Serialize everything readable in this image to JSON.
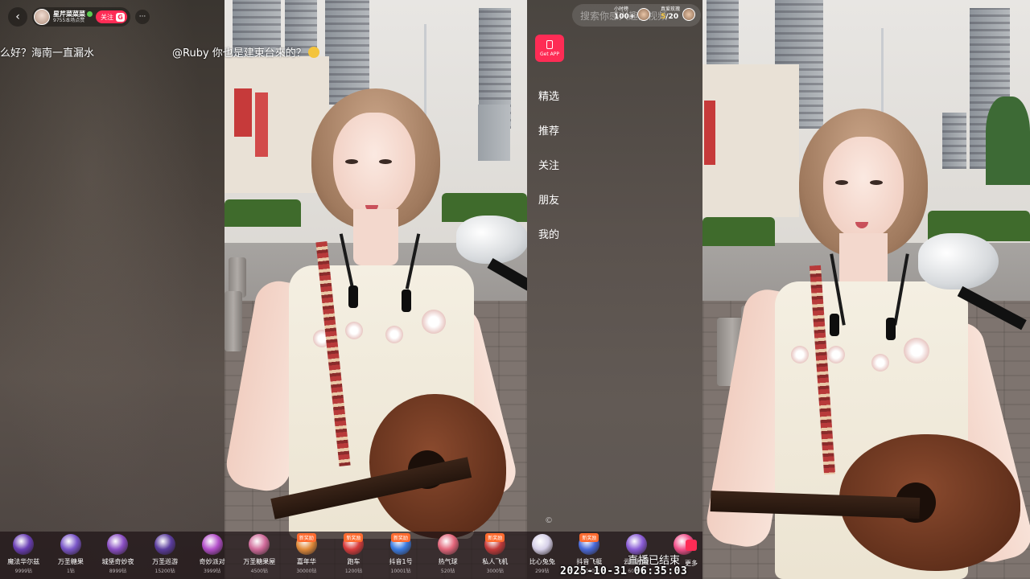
{
  "host": {
    "name": "星芹菜菜菜",
    "likes": "9755本场点赞",
    "follow_label": "关注",
    "follow_badge": "G",
    "more_label": "···",
    "back_label": "‹"
  },
  "danmaku": [
    {
      "text": "么好？海南一直漏水"
    },
    {
      "text": "@Ruby 你也是建東台來的？"
    }
  ],
  "search": {
    "placeholder": "搜索你感兴趣的视频"
  },
  "rank": [
    {
      "title": "小时榜",
      "value": "100+"
    },
    {
      "title": "真爱玫瑰",
      "value_main": "5",
      "value_rest": "/20"
    }
  ],
  "get_app": {
    "label": "Get APP"
  },
  "side_menu": {
    "items": [
      {
        "label": "精选"
      },
      {
        "label": "推荐"
      },
      {
        "label": "关注"
      },
      {
        "label": "朋友"
      },
      {
        "label": "我的"
      }
    ]
  },
  "copyright_symbol": "©",
  "gifts": [
    {
      "name": "魔法华尔兹",
      "price": "9999钻",
      "color": "#6a3fb5",
      "is_new": false
    },
    {
      "name": "万圣糖果",
      "price": "1钻",
      "color": "#7a56c8",
      "is_new": false
    },
    {
      "name": "城堡奇妙夜",
      "price": "8999钻",
      "color": "#8a4fc4",
      "is_new": false
    },
    {
      "name": "万圣巡游",
      "price": "15200钻",
      "color": "#5b3d9e",
      "is_new": false
    },
    {
      "name": "奇妙派对",
      "price": "3999钻",
      "color": "#b24fc9",
      "is_new": false
    },
    {
      "name": "万圣糖果屋",
      "price": "4500钻",
      "color": "#d06a9a",
      "is_new": false
    },
    {
      "name": "嘉年华",
      "price": "30000钻",
      "color": "#e08a3a",
      "is_new": true
    },
    {
      "name": "跑车",
      "price": "1200钻",
      "color": "#d93c3c",
      "is_new": true
    },
    {
      "name": "抖音1号",
      "price": "10001钻",
      "color": "#3a7be0",
      "is_new": true
    },
    {
      "name": "热气球",
      "price": "520钻",
      "color": "#e2657a",
      "is_new": false
    },
    {
      "name": "私人飞机",
      "price": "3000钻",
      "color": "#c43a3a",
      "is_new": true
    },
    {
      "name": "比心兔兔",
      "price": "299钻",
      "color": "#d6d0e8",
      "is_new": false
    },
    {
      "name": "抖音飞艇",
      "price": "20000钻",
      "color": "#4a6ad8",
      "is_new": true
    },
    {
      "name": "云中秘境",
      "price": "6000钻",
      "color": "#8a5cd6",
      "is_new": false
    },
    {
      "name": "",
      "price": "",
      "color": "#f0508a",
      "is_new": false
    }
  ],
  "gift_new_label": "新奖励",
  "more_gifts_label": "更多",
  "stream_ended": "直播已结束",
  "timestamp": "2025-10-31 06:35:03"
}
